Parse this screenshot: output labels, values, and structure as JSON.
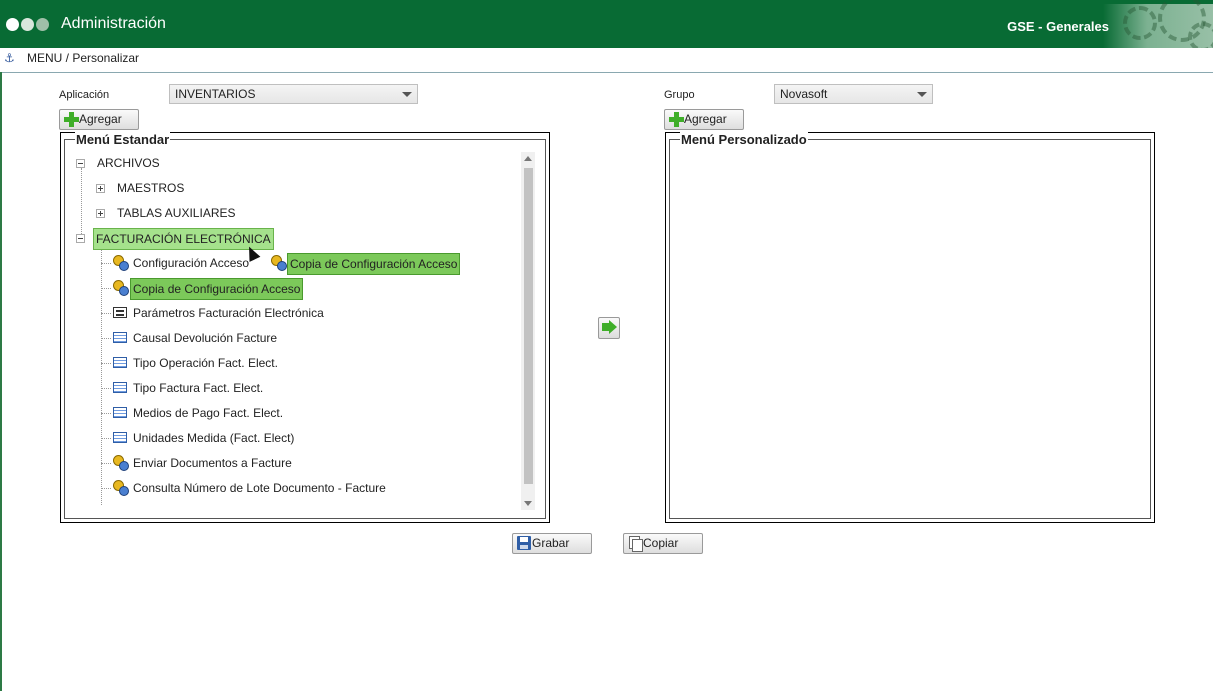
{
  "header": {
    "title": "Administración",
    "right_label": "GSE - Generales",
    "dot_colors": [
      "#ffffff",
      "#d9e6dc",
      "#9fbfa8"
    ]
  },
  "breadcrumb": {
    "text": "MENU / Personalizar"
  },
  "aplicacion": {
    "label": "Aplicación",
    "value": "INVENTARIOS"
  },
  "grupo": {
    "label": "Grupo",
    "value": "Novasoft"
  },
  "buttons": {
    "agregar_left": "Agregar",
    "agregar_right": "Agregar",
    "grabar": "Grabar",
    "copiar": "Copiar"
  },
  "menu_estandar": {
    "legend": "Menú Estandar",
    "tree": {
      "archivos": "ARCHIVOS",
      "maestros": "MAESTROS",
      "tablas_auxiliares": "TABLAS AUXILIARES",
      "facturacion": "FACTURACIÓN ELECTRÓNICA",
      "items": [
        "Configuración Acceso",
        "Copia de Configuración Acceso",
        "Parámetros Facturación Electrónica",
        "Causal Devolución Facture",
        "Tipo Operación Fact. Elect.",
        "Tipo Factura Fact. Elect.",
        "Medios de Pago Fact. Elect.",
        "Unidades Medida (Fact. Elect)",
        "Enviar Documentos a Facture",
        "Consulta Número de Lote Documento - Facture"
      ],
      "drag_ghost": "Copia de Configuración Acceso"
    }
  },
  "menu_personalizado": {
    "legend": "Menú Personalizado"
  },
  "colors": {
    "header_green": "#086b34",
    "highlight_green": "#7cc95a",
    "accent_green": "#3fae29"
  }
}
